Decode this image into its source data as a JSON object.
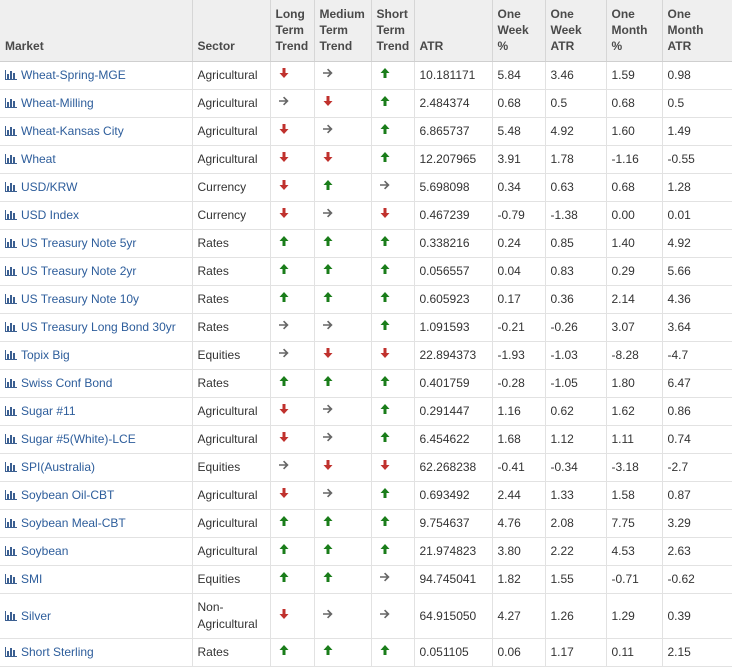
{
  "headers": {
    "market": "Market",
    "sector": "Sector",
    "long_term_trend": [
      "Long",
      "Term",
      "Trend"
    ],
    "medium_term_trend": [
      "Medium",
      "Term",
      "Trend"
    ],
    "short_term_trend": [
      "Short",
      "Term",
      "Trend"
    ],
    "atr": "ATR",
    "one_week_pct": [
      "One",
      "Week",
      "%"
    ],
    "one_week_atr": [
      "One",
      "Week",
      "ATR"
    ],
    "one_month_pct": [
      "One",
      "Month",
      "%"
    ],
    "one_month_atr": [
      "One",
      "Month",
      "ATR"
    ]
  },
  "colors": {
    "up": "#1a7d1a",
    "down": "#c0312d",
    "flat": "#666666",
    "link": "#2d5d9b",
    "icon": "#3b5f91"
  },
  "rows": [
    {
      "market": "Wheat-Spring-MGE",
      "sector": "Agricultural",
      "lt": "down",
      "mt": "flat",
      "st": "up",
      "atr": "10.181171",
      "w_pct": "5.84",
      "w_atr": "3.46",
      "m_pct": "1.59",
      "m_atr": "0.98"
    },
    {
      "market": "Wheat-Milling",
      "sector": "Agricultural",
      "lt": "flat",
      "mt": "down",
      "st": "up",
      "atr": "2.484374",
      "w_pct": "0.68",
      "w_atr": "0.5",
      "m_pct": "0.68",
      "m_atr": "0.5"
    },
    {
      "market": "Wheat-Kansas City",
      "sector": "Agricultural",
      "lt": "down",
      "mt": "flat",
      "st": "up",
      "atr": "6.865737",
      "w_pct": "5.48",
      "w_atr": "4.92",
      "m_pct": "1.60",
      "m_atr": "1.49"
    },
    {
      "market": "Wheat",
      "sector": "Agricultural",
      "lt": "down",
      "mt": "down",
      "st": "up",
      "atr": "12.207965",
      "w_pct": "3.91",
      "w_atr": "1.78",
      "m_pct": "-1.16",
      "m_atr": "-0.55"
    },
    {
      "market": "USD/KRW",
      "sector": "Currency",
      "lt": "down",
      "mt": "up",
      "st": "flat",
      "atr": "5.698098",
      "w_pct": "0.34",
      "w_atr": "0.63",
      "m_pct": "0.68",
      "m_atr": "1.28"
    },
    {
      "market": "USD Index",
      "sector": "Currency",
      "lt": "down",
      "mt": "flat",
      "st": "down",
      "atr": "0.467239",
      "w_pct": "-0.79",
      "w_atr": "-1.38",
      "m_pct": "0.00",
      "m_atr": "0.01"
    },
    {
      "market": "US Treasury Note 5yr",
      "sector": "Rates",
      "lt": "up",
      "mt": "up",
      "st": "up",
      "atr": "0.338216",
      "w_pct": "0.24",
      "w_atr": "0.85",
      "m_pct": "1.40",
      "m_atr": "4.92"
    },
    {
      "market": "US Treasury Note 2yr",
      "sector": "Rates",
      "lt": "up",
      "mt": "up",
      "st": "up",
      "atr": "0.056557",
      "w_pct": "0.04",
      "w_atr": "0.83",
      "m_pct": "0.29",
      "m_atr": "5.66"
    },
    {
      "market": "US Treasury Note 10y",
      "sector": "Rates",
      "lt": "up",
      "mt": "up",
      "st": "up",
      "atr": "0.605923",
      "w_pct": "0.17",
      "w_atr": "0.36",
      "m_pct": "2.14",
      "m_atr": "4.36"
    },
    {
      "market": "US Treasury Long Bond 30yr",
      "sector": "Rates",
      "lt": "flat",
      "mt": "flat",
      "st": "up",
      "atr": "1.091593",
      "w_pct": "-0.21",
      "w_atr": "-0.26",
      "m_pct": "3.07",
      "m_atr": "3.64"
    },
    {
      "market": "Topix Big",
      "sector": "Equities",
      "lt": "flat",
      "mt": "down",
      "st": "down",
      "atr": "22.894373",
      "w_pct": "-1.93",
      "w_atr": "-1.03",
      "m_pct": "-8.28",
      "m_atr": "-4.7"
    },
    {
      "market": "Swiss Conf Bond",
      "sector": "Rates",
      "lt": "up",
      "mt": "up",
      "st": "up",
      "atr": "0.401759",
      "w_pct": "-0.28",
      "w_atr": "-1.05",
      "m_pct": "1.80",
      "m_atr": "6.47"
    },
    {
      "market": "Sugar #11",
      "sector": "Agricultural",
      "lt": "down",
      "mt": "flat",
      "st": "up",
      "atr": "0.291447",
      "w_pct": "1.16",
      "w_atr": "0.62",
      "m_pct": "1.62",
      "m_atr": "0.86"
    },
    {
      "market": "Sugar #5(White)-LCE",
      "sector": "Agricultural",
      "lt": "down",
      "mt": "flat",
      "st": "up",
      "atr": "6.454622",
      "w_pct": "1.68",
      "w_atr": "1.12",
      "m_pct": "1.11",
      "m_atr": "0.74"
    },
    {
      "market": "SPI(Australia)",
      "sector": "Equities",
      "lt": "flat",
      "mt": "down",
      "st": "down",
      "atr": "62.268238",
      "w_pct": "-0.41",
      "w_atr": "-0.34",
      "m_pct": "-3.18",
      "m_atr": "-2.7"
    },
    {
      "market": "Soybean Oil-CBT",
      "sector": "Agricultural",
      "lt": "down",
      "mt": "flat",
      "st": "up",
      "atr": "0.693492",
      "w_pct": "2.44",
      "w_atr": "1.33",
      "m_pct": "1.58",
      "m_atr": "0.87"
    },
    {
      "market": "Soybean Meal-CBT",
      "sector": "Agricultural",
      "lt": "up",
      "mt": "up",
      "st": "up",
      "atr": "9.754637",
      "w_pct": "4.76",
      "w_atr": "2.08",
      "m_pct": "7.75",
      "m_atr": "3.29"
    },
    {
      "market": "Soybean",
      "sector": "Agricultural",
      "lt": "up",
      "mt": "up",
      "st": "up",
      "atr": "21.974823",
      "w_pct": "3.80",
      "w_atr": "2.22",
      "m_pct": "4.53",
      "m_atr": "2.63"
    },
    {
      "market": "SMI",
      "sector": "Equities",
      "lt": "up",
      "mt": "up",
      "st": "flat",
      "atr": "94.745041",
      "w_pct": "1.82",
      "w_atr": "1.55",
      "m_pct": "-0.71",
      "m_atr": "-0.62"
    },
    {
      "market": "Silver",
      "sector": "Non-Agricultural",
      "lt": "down",
      "mt": "flat",
      "st": "flat",
      "atr": "64.915050",
      "w_pct": "4.27",
      "w_atr": "1.26",
      "m_pct": "1.29",
      "m_atr": "0.39",
      "tall": true
    },
    {
      "market": "Short Sterling",
      "sector": "Rates",
      "lt": "up",
      "mt": "up",
      "st": "up",
      "atr": "0.051105",
      "w_pct": "0.06",
      "w_atr": "1.17",
      "m_pct": "0.11",
      "m_atr": "2.15"
    }
  ]
}
